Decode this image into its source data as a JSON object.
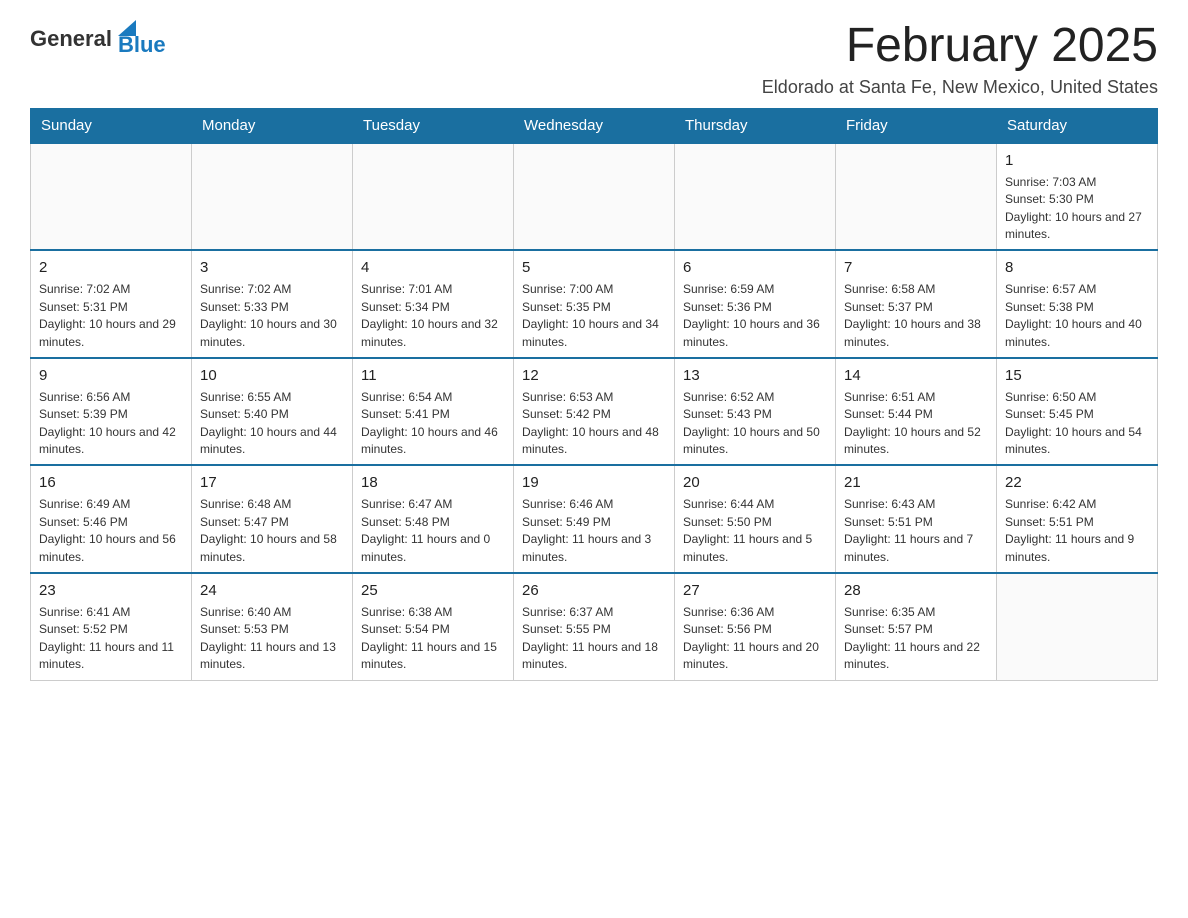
{
  "header": {
    "logo_general": "General",
    "logo_blue": "Blue",
    "title": "February 2025",
    "location": "Eldorado at Santa Fe, New Mexico, United States"
  },
  "days_of_week": [
    "Sunday",
    "Monday",
    "Tuesday",
    "Wednesday",
    "Thursday",
    "Friday",
    "Saturday"
  ],
  "weeks": [
    [
      {
        "day": "",
        "info": ""
      },
      {
        "day": "",
        "info": ""
      },
      {
        "day": "",
        "info": ""
      },
      {
        "day": "",
        "info": ""
      },
      {
        "day": "",
        "info": ""
      },
      {
        "day": "",
        "info": ""
      },
      {
        "day": "1",
        "info": "Sunrise: 7:03 AM\nSunset: 5:30 PM\nDaylight: 10 hours and 27 minutes."
      }
    ],
    [
      {
        "day": "2",
        "info": "Sunrise: 7:02 AM\nSunset: 5:31 PM\nDaylight: 10 hours and 29 minutes."
      },
      {
        "day": "3",
        "info": "Sunrise: 7:02 AM\nSunset: 5:33 PM\nDaylight: 10 hours and 30 minutes."
      },
      {
        "day": "4",
        "info": "Sunrise: 7:01 AM\nSunset: 5:34 PM\nDaylight: 10 hours and 32 minutes."
      },
      {
        "day": "5",
        "info": "Sunrise: 7:00 AM\nSunset: 5:35 PM\nDaylight: 10 hours and 34 minutes."
      },
      {
        "day": "6",
        "info": "Sunrise: 6:59 AM\nSunset: 5:36 PM\nDaylight: 10 hours and 36 minutes."
      },
      {
        "day": "7",
        "info": "Sunrise: 6:58 AM\nSunset: 5:37 PM\nDaylight: 10 hours and 38 minutes."
      },
      {
        "day": "8",
        "info": "Sunrise: 6:57 AM\nSunset: 5:38 PM\nDaylight: 10 hours and 40 minutes."
      }
    ],
    [
      {
        "day": "9",
        "info": "Sunrise: 6:56 AM\nSunset: 5:39 PM\nDaylight: 10 hours and 42 minutes."
      },
      {
        "day": "10",
        "info": "Sunrise: 6:55 AM\nSunset: 5:40 PM\nDaylight: 10 hours and 44 minutes."
      },
      {
        "day": "11",
        "info": "Sunrise: 6:54 AM\nSunset: 5:41 PM\nDaylight: 10 hours and 46 minutes."
      },
      {
        "day": "12",
        "info": "Sunrise: 6:53 AM\nSunset: 5:42 PM\nDaylight: 10 hours and 48 minutes."
      },
      {
        "day": "13",
        "info": "Sunrise: 6:52 AM\nSunset: 5:43 PM\nDaylight: 10 hours and 50 minutes."
      },
      {
        "day": "14",
        "info": "Sunrise: 6:51 AM\nSunset: 5:44 PM\nDaylight: 10 hours and 52 minutes."
      },
      {
        "day": "15",
        "info": "Sunrise: 6:50 AM\nSunset: 5:45 PM\nDaylight: 10 hours and 54 minutes."
      }
    ],
    [
      {
        "day": "16",
        "info": "Sunrise: 6:49 AM\nSunset: 5:46 PM\nDaylight: 10 hours and 56 minutes."
      },
      {
        "day": "17",
        "info": "Sunrise: 6:48 AM\nSunset: 5:47 PM\nDaylight: 10 hours and 58 minutes."
      },
      {
        "day": "18",
        "info": "Sunrise: 6:47 AM\nSunset: 5:48 PM\nDaylight: 11 hours and 0 minutes."
      },
      {
        "day": "19",
        "info": "Sunrise: 6:46 AM\nSunset: 5:49 PM\nDaylight: 11 hours and 3 minutes."
      },
      {
        "day": "20",
        "info": "Sunrise: 6:44 AM\nSunset: 5:50 PM\nDaylight: 11 hours and 5 minutes."
      },
      {
        "day": "21",
        "info": "Sunrise: 6:43 AM\nSunset: 5:51 PM\nDaylight: 11 hours and 7 minutes."
      },
      {
        "day": "22",
        "info": "Sunrise: 6:42 AM\nSunset: 5:51 PM\nDaylight: 11 hours and 9 minutes."
      }
    ],
    [
      {
        "day": "23",
        "info": "Sunrise: 6:41 AM\nSunset: 5:52 PM\nDaylight: 11 hours and 11 minutes."
      },
      {
        "day": "24",
        "info": "Sunrise: 6:40 AM\nSunset: 5:53 PM\nDaylight: 11 hours and 13 minutes."
      },
      {
        "day": "25",
        "info": "Sunrise: 6:38 AM\nSunset: 5:54 PM\nDaylight: 11 hours and 15 minutes."
      },
      {
        "day": "26",
        "info": "Sunrise: 6:37 AM\nSunset: 5:55 PM\nDaylight: 11 hours and 18 minutes."
      },
      {
        "day": "27",
        "info": "Sunrise: 6:36 AM\nSunset: 5:56 PM\nDaylight: 11 hours and 20 minutes."
      },
      {
        "day": "28",
        "info": "Sunrise: 6:35 AM\nSunset: 5:57 PM\nDaylight: 11 hours and 22 minutes."
      },
      {
        "day": "",
        "info": ""
      }
    ]
  ]
}
